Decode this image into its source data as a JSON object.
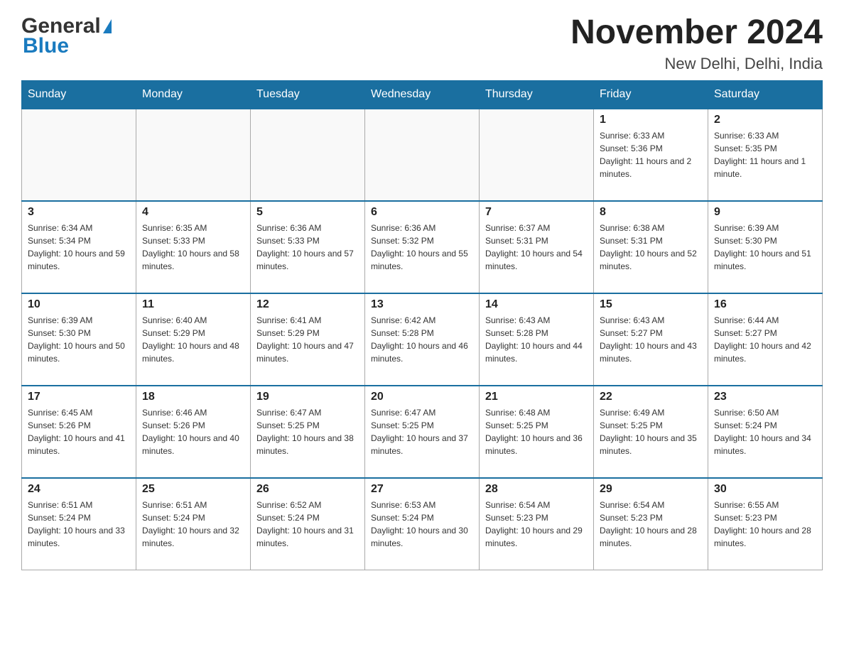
{
  "header": {
    "title": "November 2024",
    "location": "New Delhi, Delhi, India",
    "logo_general": "General",
    "logo_blue": "Blue"
  },
  "days_of_week": [
    "Sunday",
    "Monday",
    "Tuesday",
    "Wednesday",
    "Thursday",
    "Friday",
    "Saturday"
  ],
  "weeks": [
    {
      "days": [
        {
          "number": "",
          "info": ""
        },
        {
          "number": "",
          "info": ""
        },
        {
          "number": "",
          "info": ""
        },
        {
          "number": "",
          "info": ""
        },
        {
          "number": "",
          "info": ""
        },
        {
          "number": "1",
          "info": "Sunrise: 6:33 AM\nSunset: 5:36 PM\nDaylight: 11 hours and 2 minutes."
        },
        {
          "number": "2",
          "info": "Sunrise: 6:33 AM\nSunset: 5:35 PM\nDaylight: 11 hours and 1 minute."
        }
      ]
    },
    {
      "days": [
        {
          "number": "3",
          "info": "Sunrise: 6:34 AM\nSunset: 5:34 PM\nDaylight: 10 hours and 59 minutes."
        },
        {
          "number": "4",
          "info": "Sunrise: 6:35 AM\nSunset: 5:33 PM\nDaylight: 10 hours and 58 minutes."
        },
        {
          "number": "5",
          "info": "Sunrise: 6:36 AM\nSunset: 5:33 PM\nDaylight: 10 hours and 57 minutes."
        },
        {
          "number": "6",
          "info": "Sunrise: 6:36 AM\nSunset: 5:32 PM\nDaylight: 10 hours and 55 minutes."
        },
        {
          "number": "7",
          "info": "Sunrise: 6:37 AM\nSunset: 5:31 PM\nDaylight: 10 hours and 54 minutes."
        },
        {
          "number": "8",
          "info": "Sunrise: 6:38 AM\nSunset: 5:31 PM\nDaylight: 10 hours and 52 minutes."
        },
        {
          "number": "9",
          "info": "Sunrise: 6:39 AM\nSunset: 5:30 PM\nDaylight: 10 hours and 51 minutes."
        }
      ]
    },
    {
      "days": [
        {
          "number": "10",
          "info": "Sunrise: 6:39 AM\nSunset: 5:30 PM\nDaylight: 10 hours and 50 minutes."
        },
        {
          "number": "11",
          "info": "Sunrise: 6:40 AM\nSunset: 5:29 PM\nDaylight: 10 hours and 48 minutes."
        },
        {
          "number": "12",
          "info": "Sunrise: 6:41 AM\nSunset: 5:29 PM\nDaylight: 10 hours and 47 minutes."
        },
        {
          "number": "13",
          "info": "Sunrise: 6:42 AM\nSunset: 5:28 PM\nDaylight: 10 hours and 46 minutes."
        },
        {
          "number": "14",
          "info": "Sunrise: 6:43 AM\nSunset: 5:28 PM\nDaylight: 10 hours and 44 minutes."
        },
        {
          "number": "15",
          "info": "Sunrise: 6:43 AM\nSunset: 5:27 PM\nDaylight: 10 hours and 43 minutes."
        },
        {
          "number": "16",
          "info": "Sunrise: 6:44 AM\nSunset: 5:27 PM\nDaylight: 10 hours and 42 minutes."
        }
      ]
    },
    {
      "days": [
        {
          "number": "17",
          "info": "Sunrise: 6:45 AM\nSunset: 5:26 PM\nDaylight: 10 hours and 41 minutes."
        },
        {
          "number": "18",
          "info": "Sunrise: 6:46 AM\nSunset: 5:26 PM\nDaylight: 10 hours and 40 minutes."
        },
        {
          "number": "19",
          "info": "Sunrise: 6:47 AM\nSunset: 5:25 PM\nDaylight: 10 hours and 38 minutes."
        },
        {
          "number": "20",
          "info": "Sunrise: 6:47 AM\nSunset: 5:25 PM\nDaylight: 10 hours and 37 minutes."
        },
        {
          "number": "21",
          "info": "Sunrise: 6:48 AM\nSunset: 5:25 PM\nDaylight: 10 hours and 36 minutes."
        },
        {
          "number": "22",
          "info": "Sunrise: 6:49 AM\nSunset: 5:25 PM\nDaylight: 10 hours and 35 minutes."
        },
        {
          "number": "23",
          "info": "Sunrise: 6:50 AM\nSunset: 5:24 PM\nDaylight: 10 hours and 34 minutes."
        }
      ]
    },
    {
      "days": [
        {
          "number": "24",
          "info": "Sunrise: 6:51 AM\nSunset: 5:24 PM\nDaylight: 10 hours and 33 minutes."
        },
        {
          "number": "25",
          "info": "Sunrise: 6:51 AM\nSunset: 5:24 PM\nDaylight: 10 hours and 32 minutes."
        },
        {
          "number": "26",
          "info": "Sunrise: 6:52 AM\nSunset: 5:24 PM\nDaylight: 10 hours and 31 minutes."
        },
        {
          "number": "27",
          "info": "Sunrise: 6:53 AM\nSunset: 5:24 PM\nDaylight: 10 hours and 30 minutes."
        },
        {
          "number": "28",
          "info": "Sunrise: 6:54 AM\nSunset: 5:23 PM\nDaylight: 10 hours and 29 minutes."
        },
        {
          "number": "29",
          "info": "Sunrise: 6:54 AM\nSunset: 5:23 PM\nDaylight: 10 hours and 28 minutes."
        },
        {
          "number": "30",
          "info": "Sunrise: 6:55 AM\nSunset: 5:23 PM\nDaylight: 10 hours and 28 minutes."
        }
      ]
    }
  ]
}
